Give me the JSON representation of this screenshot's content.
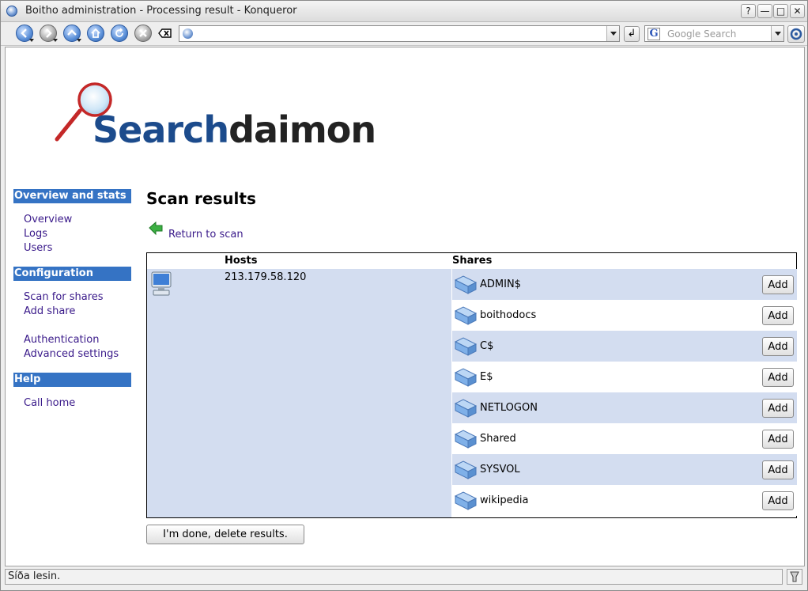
{
  "window": {
    "title": "Boitho administration - Processing result - Konqueror",
    "controls": {
      "help": "?",
      "minimize": "—",
      "maximize": "□",
      "close": "✕"
    }
  },
  "toolbar": {
    "url_value": "",
    "search_placeholder": "Google Search",
    "go_label": "↲"
  },
  "logo": {
    "search": "Search",
    "daimon": "daimon"
  },
  "sidebar": {
    "sections": [
      {
        "title": "Overview and stats",
        "items": [
          "Overview",
          "Logs",
          "Users"
        ]
      },
      {
        "title": "Configuration",
        "items": [
          "Scan for shares",
          "Add share",
          "Authentication",
          "Advanced settings"
        ]
      },
      {
        "title": "Help",
        "items": [
          "Call home"
        ]
      }
    ]
  },
  "main": {
    "title": "Scan results",
    "return_link": "Return to scan",
    "table": {
      "hosts_header": "Hosts",
      "shares_header": "Shares",
      "host": "213.179.58.120",
      "add_label": "Add",
      "shares": [
        "ADMIN$",
        "boithodocs",
        "C$",
        "E$",
        "NETLOGON",
        "Shared",
        "SYSVOL",
        "wikipedia"
      ]
    },
    "done_button": "I'm done, delete results."
  },
  "status": {
    "text": "Síða lesin."
  },
  "colors": {
    "sidebar_header": "#3573c4",
    "row_highlight": "#d3ddf0",
    "link": "#3a1a8a",
    "logo_blue": "#1c4b8c"
  }
}
